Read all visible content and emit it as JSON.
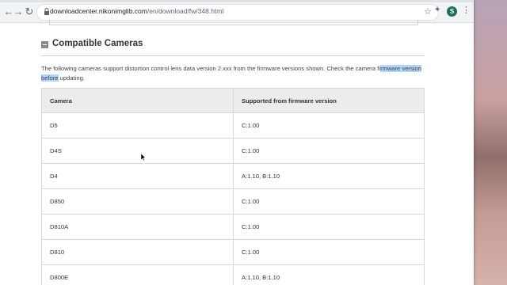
{
  "browser": {
    "url_host": "downloadcenter.nikonimglib.com",
    "url_path": "/en/download/fw/348.html",
    "profile_initial": "S",
    "back_icon": "←",
    "forward_icon": "→",
    "reload_icon": "↻",
    "star_icon": "☆",
    "extensions_icon": "✦",
    "menu_icon": "⋮"
  },
  "section": {
    "title": "Compatible Cameras",
    "desc_before": "The following cameras support distortion control lens data version 2.xxx from the firmware versions shown. Check the camera fi",
    "desc_highlight": "rmware version before",
    "desc_after": " updating."
  },
  "table": {
    "headers": [
      "Camera",
      "Supported from firmware version"
    ],
    "rows": [
      [
        "D5",
        "C:1.00"
      ],
      [
        "D4S",
        "C:1.00"
      ],
      [
        "D4",
        "A:1.10, B:1.10"
      ],
      [
        "D850",
        "C:1.00"
      ],
      [
        "D810A",
        "C:1.00"
      ],
      [
        "D810",
        "C:1.00"
      ],
      [
        "D800E",
        "A:1.10, B:1.10"
      ]
    ]
  }
}
